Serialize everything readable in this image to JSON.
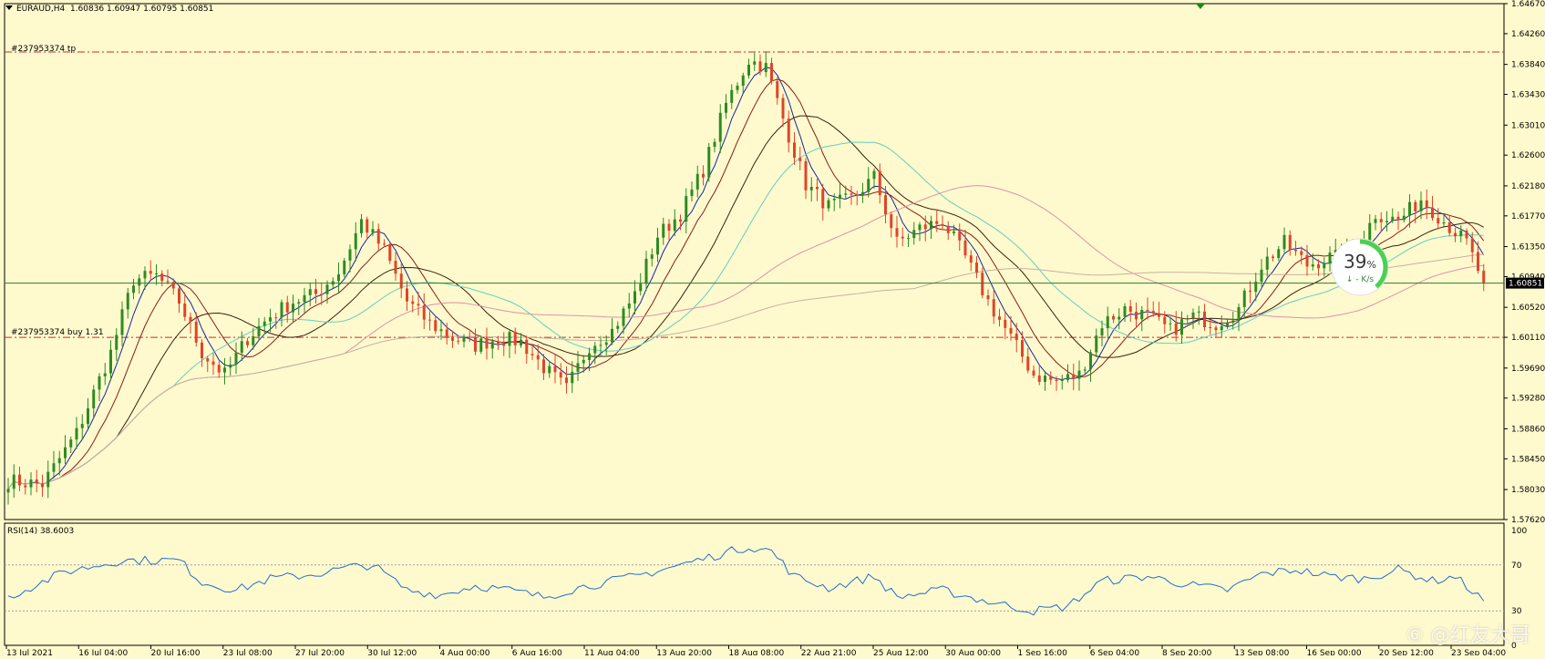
{
  "header": {
    "symbol": "EURAUD,H4",
    "ohlc": "1.60836 1.60947 1.60795 1.60851"
  },
  "orders": {
    "tp_label": "#237953374 tp",
    "buy_label": "#237953374 buy 1.31",
    "tp_price": 1.6401,
    "entry_price": 1.6011
  },
  "current_price": {
    "value": 1.60851,
    "label": "1.60851"
  },
  "gauge": {
    "percent_label": "39",
    "percent_sign": "%",
    "speed_label": "↓ - K/s",
    "percent": 0.39
  },
  "rsi": {
    "label": "RSI(14) 38.6003",
    "levels": [
      "100",
      "70",
      "30",
      "0"
    ]
  },
  "watermark": "⑥ @红友大哥",
  "colors": {
    "background": "#fffacd",
    "bull": "#2e8b22",
    "bear": "#e0442a",
    "ma_fast": "#1428a0",
    "ma_mid": "#8b1a1a",
    "ma_slow": "#3c2010",
    "ma_teal": "#5fd0c0",
    "ma_pink": "#e090a8",
    "ma_tan": "#c8b0a0",
    "order_line": "#c03030",
    "price_line": "#2e7d32",
    "rsi_line": "#1e6fd0"
  },
  "chart_data": {
    "type": "candlestick",
    "title": "EURAUD,H4",
    "ylim": [
      1.5762,
      1.6467
    ],
    "ytick_labels": [
      "1.64670",
      "1.64260",
      "1.63840",
      "1.63430",
      "1.63010",
      "1.62600",
      "1.62180",
      "1.61770",
      "1.61350",
      "1.60940",
      "1.60520",
      "1.60110",
      "1.59690",
      "1.59280",
      "1.58860",
      "1.58450",
      "1.58030",
      "1.57620"
    ],
    "xtick_labels": [
      "13 Jul 2021",
      "16 Jul 04:00",
      "20 Jul 16:00",
      "23 Jul 08:00",
      "27 Jul 20:00",
      "30 Jul 12:00",
      "4 Aug 00:00",
      "6 Aug 16:00",
      "11 Aug 04:00",
      "13 Aug 20:00",
      "18 Aug 08:00",
      "22 Aug 21:00",
      "25 Aug 12:00",
      "30 Aug 00:00",
      "1 Sep 16:00",
      "6 Sep 04:00",
      "8 Sep 20:00",
      "13 Sep 08:00",
      "16 Sep 00:00",
      "20 Sep 12:00",
      "23 Sep 04:00"
    ],
    "close_waypoints": [
      [
        0,
        1.5815
      ],
      [
        6,
        1.581
      ],
      [
        12,
        1.588
      ],
      [
        18,
        1.599
      ],
      [
        22,
        1.609
      ],
      [
        26,
        1.6095
      ],
      [
        30,
        1.606
      ],
      [
        34,
        1.599
      ],
      [
        38,
        1.596
      ],
      [
        42,
        1.601
      ],
      [
        46,
        1.604
      ],
      [
        50,
        1.606
      ],
      [
        54,
        1.607
      ],
      [
        58,
        1.61
      ],
      [
        62,
        1.617
      ],
      [
        66,
        1.613
      ],
      [
        70,
        1.606
      ],
      [
        74,
        1.603
      ],
      [
        78,
        1.601
      ],
      [
        82,
        1.6
      ],
      [
        86,
        1.601
      ],
      [
        90,
        1.6005
      ],
      [
        94,
        1.597
      ],
      [
        98,
        1.594
      ],
      [
        102,
        1.6
      ],
      [
        106,
        1.602
      ],
      [
        110,
        1.607
      ],
      [
        114,
        1.615
      ],
      [
        118,
        1.618
      ],
      [
        122,
        1.624
      ],
      [
        126,
        1.633
      ],
      [
        130,
        1.639
      ],
      [
        133,
        1.638
      ],
      [
        136,
        1.631
      ],
      [
        140,
        1.622
      ],
      [
        144,
        1.619
      ],
      [
        148,
        1.62
      ],
      [
        152,
        1.623
      ],
      [
        156,
        1.614
      ],
      [
        160,
        1.616
      ],
      [
        164,
        1.617
      ],
      [
        168,
        1.612
      ],
      [
        172,
        1.606
      ],
      [
        176,
        1.601
      ],
      [
        180,
        1.596
      ],
      [
        184,
        1.595
      ],
      [
        188,
        1.596
      ],
      [
        192,
        1.603
      ],
      [
        196,
        1.605
      ],
      [
        200,
        1.604
      ],
      [
        204,
        1.602
      ],
      [
        208,
        1.604
      ],
      [
        212,
        1.603
      ],
      [
        216,
        1.605
      ],
      [
        220,
        1.611
      ],
      [
        224,
        1.614
      ],
      [
        228,
        1.611
      ],
      [
        232,
        1.612
      ],
      [
        236,
        1.612
      ],
      [
        240,
        1.618
      ],
      [
        244,
        1.617
      ],
      [
        248,
        1.62
      ],
      [
        252,
        1.617
      ],
      [
        256,
        1.614
      ],
      [
        259,
        1.6085
      ]
    ],
    "rsi_waypoints": [
      [
        0,
        42
      ],
      [
        10,
        64
      ],
      [
        20,
        74
      ],
      [
        30,
        74
      ],
      [
        34,
        55
      ],
      [
        40,
        48
      ],
      [
        46,
        58
      ],
      [
        54,
        62
      ],
      [
        60,
        68
      ],
      [
        64,
        70
      ],
      [
        70,
        48
      ],
      [
        76,
        44
      ],
      [
        82,
        52
      ],
      [
        88,
        48
      ],
      [
        94,
        42
      ],
      [
        100,
        50
      ],
      [
        110,
        60
      ],
      [
        118,
        70
      ],
      [
        124,
        78
      ],
      [
        130,
        86
      ],
      [
        134,
        82
      ],
      [
        138,
        60
      ],
      [
        144,
        50
      ],
      [
        152,
        60
      ],
      [
        156,
        42
      ],
      [
        164,
        48
      ],
      [
        172,
        38
      ],
      [
        180,
        30
      ],
      [
        186,
        34
      ],
      [
        192,
        56
      ],
      [
        200,
        60
      ],
      [
        208,
        52
      ],
      [
        214,
        48
      ],
      [
        220,
        62
      ],
      [
        226,
        66
      ],
      [
        232,
        60
      ],
      [
        238,
        58
      ],
      [
        244,
        66
      ],
      [
        250,
        56
      ],
      [
        254,
        60
      ],
      [
        259,
        38.6
      ]
    ],
    "count": 260
  }
}
